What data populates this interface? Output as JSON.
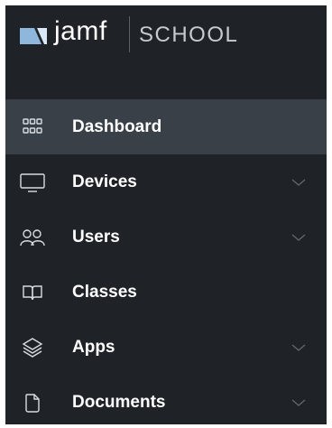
{
  "brand": {
    "logo_icon": "jamf-logo-icon",
    "name": "jamf",
    "product": "SCHOOL"
  },
  "colors": {
    "sidebar_bg": "#1f2327",
    "active_bg": "#394047",
    "text": "#ffffff",
    "icon": "#d9dde1",
    "chevron": "#5f666d"
  },
  "nav": {
    "items": [
      {
        "label": "Dashboard",
        "icon": "grid-icon",
        "active": true,
        "has_submenu": false
      },
      {
        "label": "Devices",
        "icon": "monitor-icon",
        "active": false,
        "has_submenu": true
      },
      {
        "label": "Users",
        "icon": "users-icon",
        "active": false,
        "has_submenu": true
      },
      {
        "label": "Classes",
        "icon": "book-icon",
        "active": false,
        "has_submenu": false
      },
      {
        "label": "Apps",
        "icon": "layers-icon",
        "active": false,
        "has_submenu": true
      },
      {
        "label": "Documents",
        "icon": "document-icon",
        "active": false,
        "has_submenu": true
      }
    ]
  }
}
